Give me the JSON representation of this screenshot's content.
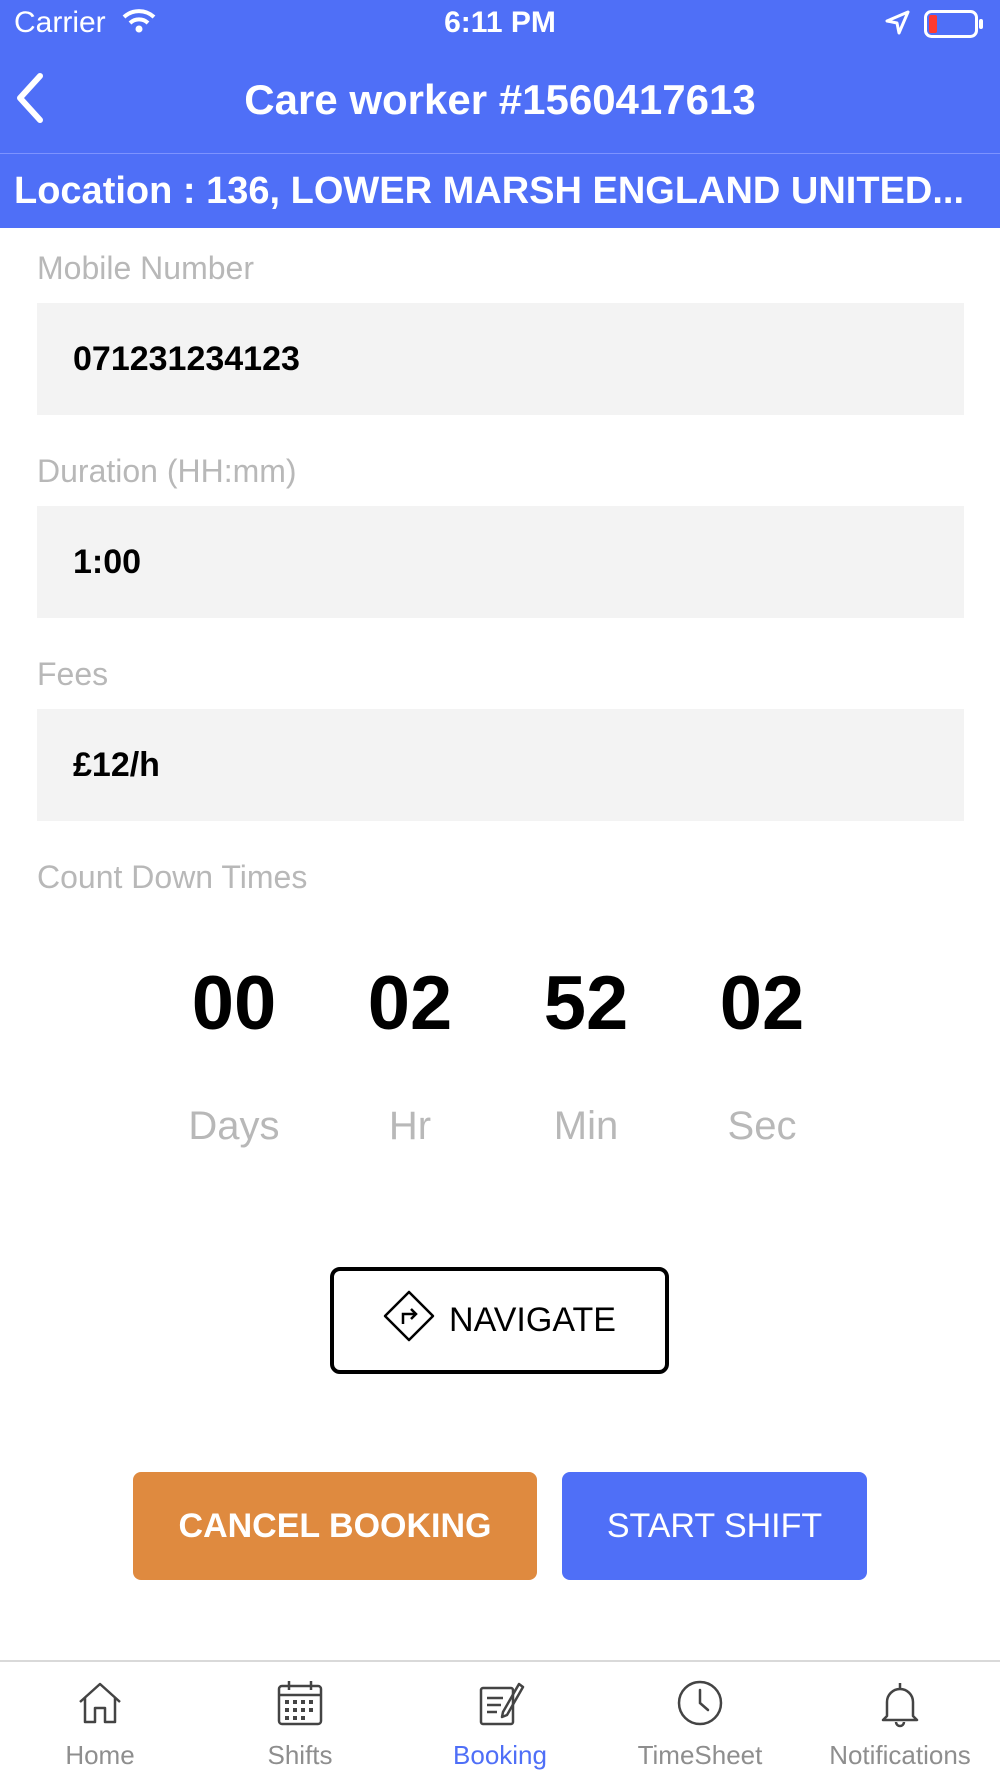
{
  "status_bar": {
    "carrier": "Carrier",
    "time": "6:11 PM"
  },
  "header": {
    "title": "Care worker #1560417613"
  },
  "location": {
    "text": "Location :  136, LOWER MARSH ENGLAND UNITED..."
  },
  "fields": {
    "mobile": {
      "label": "Mobile Number",
      "value": "071231234123"
    },
    "duration": {
      "label": "Duration (HH:mm)",
      "value": "1:00"
    },
    "fees": {
      "label": "Fees",
      "value": "£12/h"
    }
  },
  "countdown": {
    "label": "Count Down Times",
    "days": "00",
    "hours": "02",
    "minutes": "52",
    "seconds": "02",
    "units": {
      "days": "Days",
      "hours": "Hr",
      "minutes": "Min",
      "seconds": "Sec"
    }
  },
  "buttons": {
    "navigate": "NAVIGATE",
    "cancel": "CANCEL BOOKING",
    "start": "START SHIFT"
  },
  "tabs": [
    {
      "label": "Home",
      "icon": "home-icon"
    },
    {
      "label": "Shifts",
      "icon": "calendar-icon"
    },
    {
      "label": "Booking",
      "icon": "booking-icon",
      "active": true
    },
    {
      "label": "TimeSheet",
      "icon": "clock-icon"
    },
    {
      "label": "Notifications",
      "icon": "bell-icon"
    }
  ],
  "colors": {
    "primary": "#4f6ff7",
    "cancel": "#df8a3f",
    "field_bg": "#f3f3f3",
    "label": "#b8b8b8"
  }
}
